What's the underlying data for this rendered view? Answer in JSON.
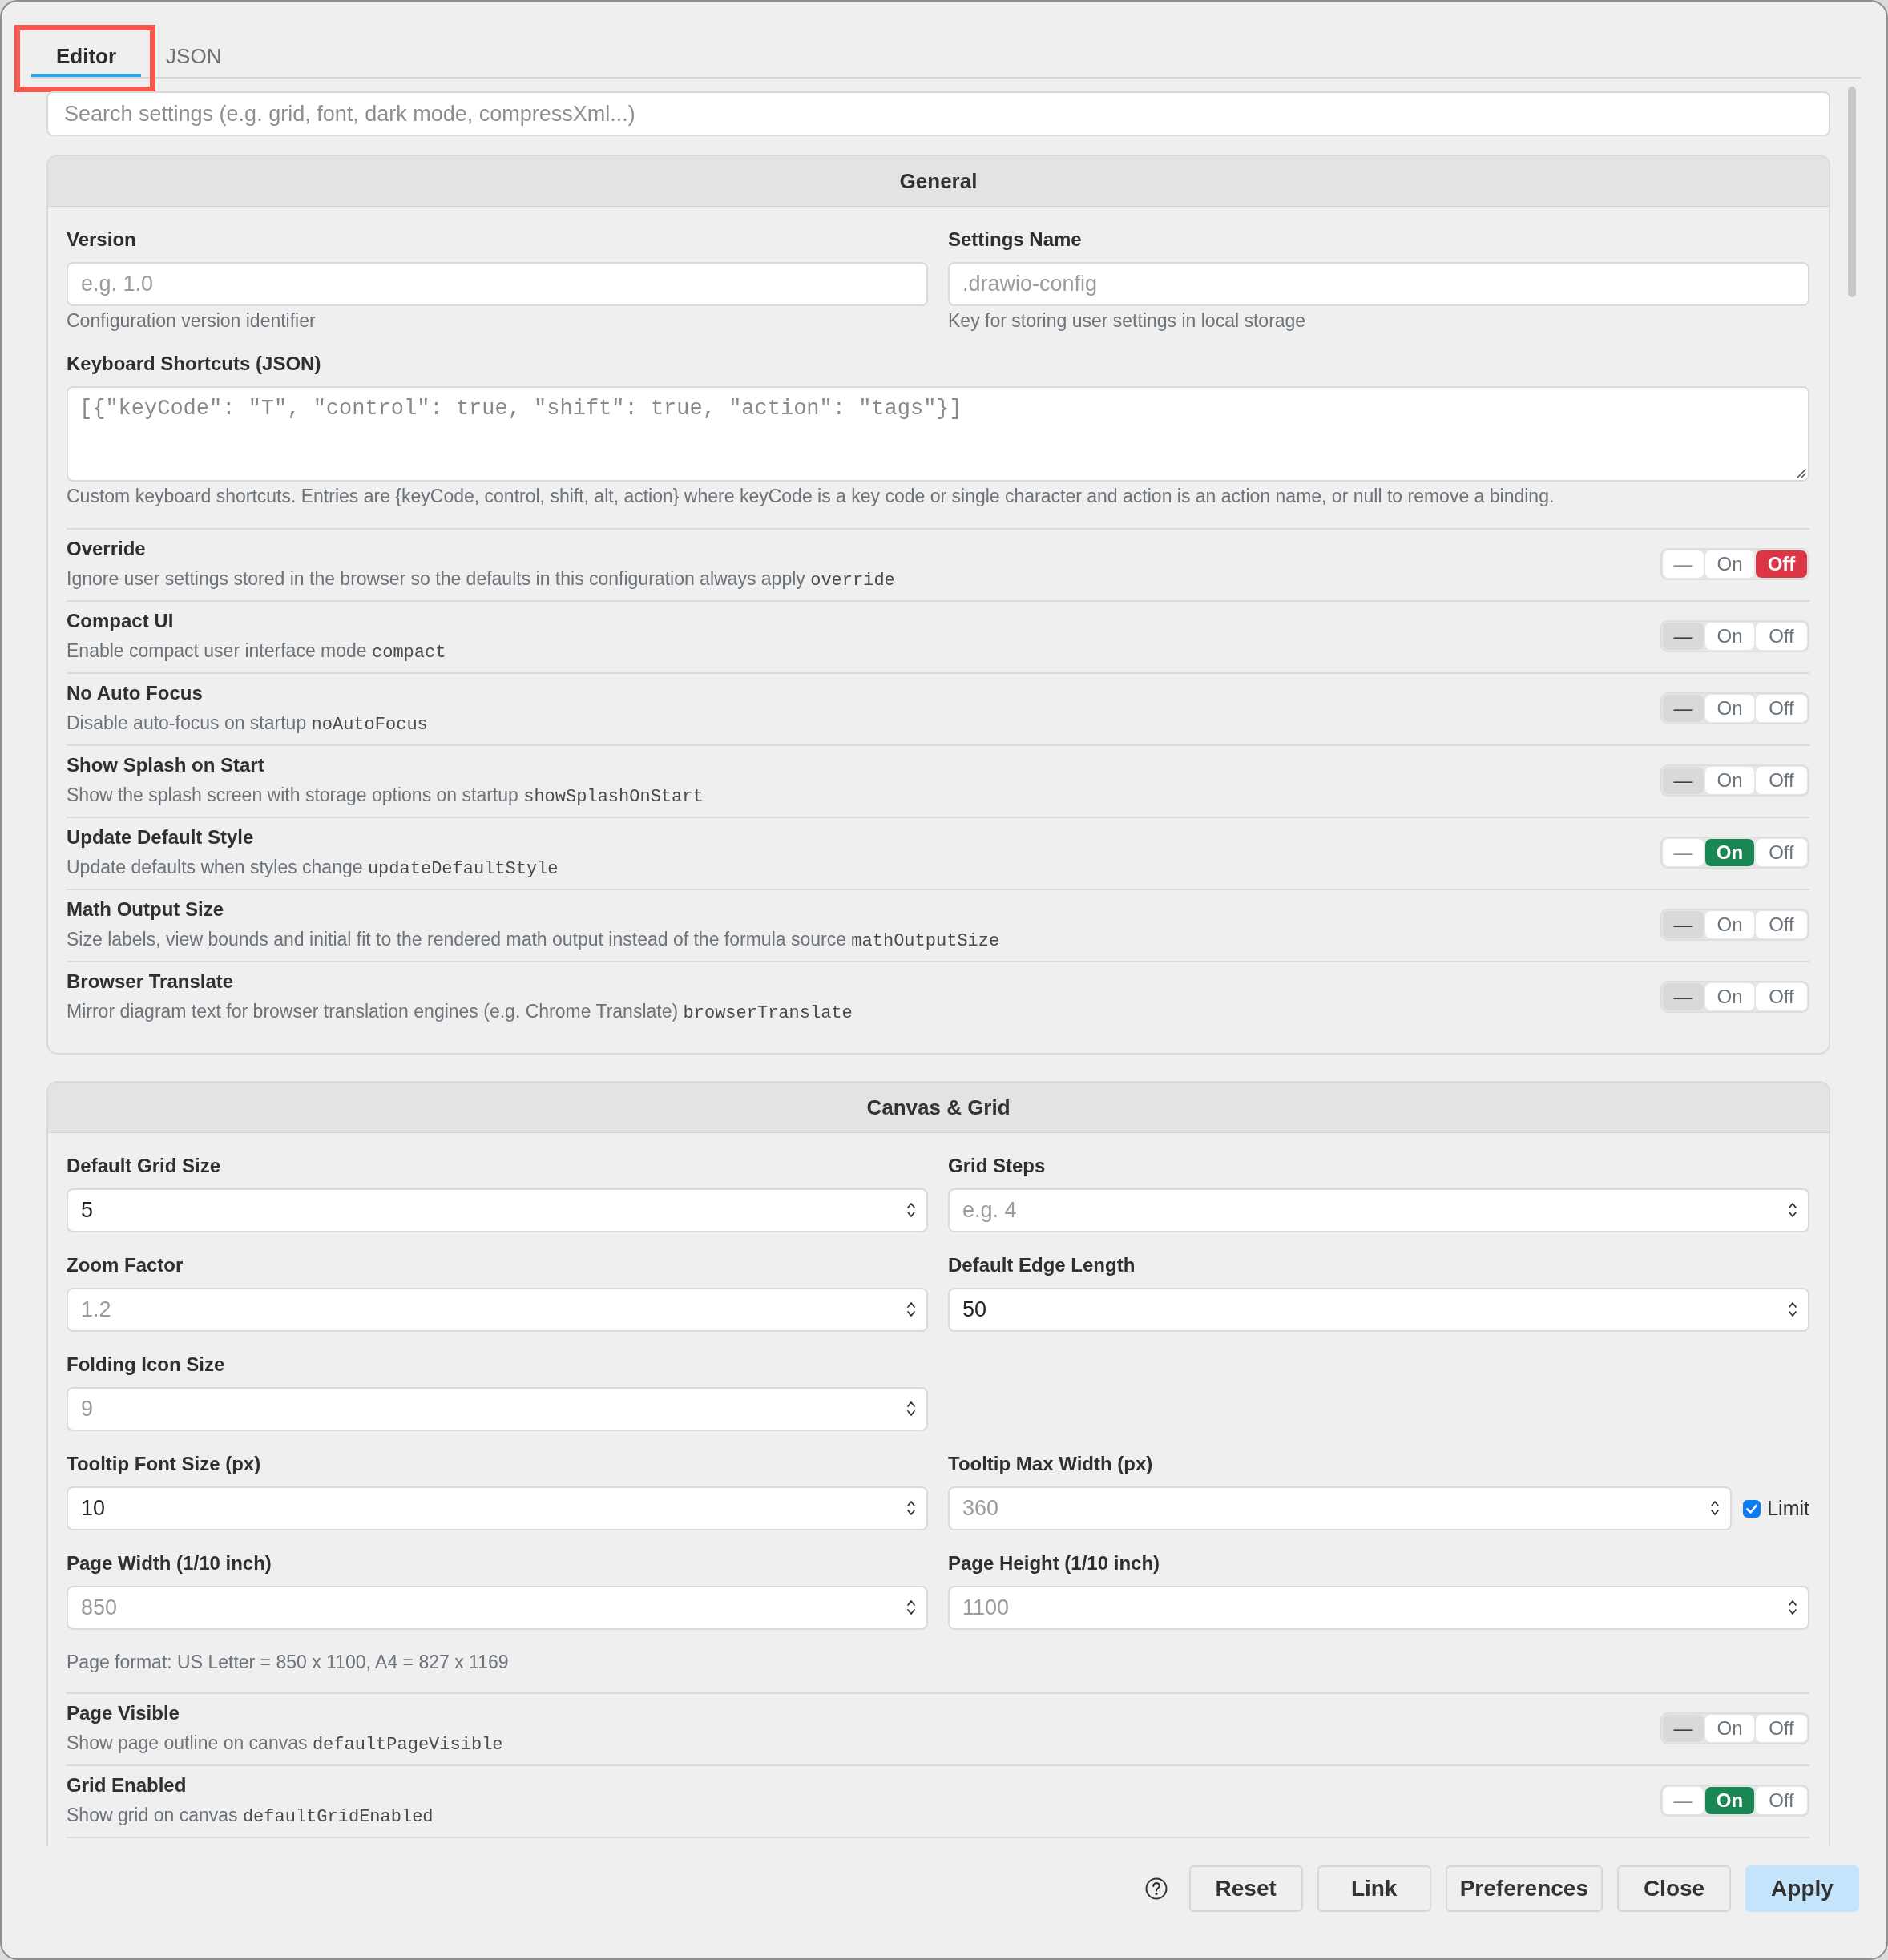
{
  "tabs": [
    {
      "label": "Editor",
      "selected": true,
      "highlighted": true
    },
    {
      "label": "JSON",
      "selected": false,
      "highlighted": false
    }
  ],
  "search": {
    "placeholder": "Search settings (e.g. grid, font, dark mode, compressXml...)"
  },
  "sections": [
    {
      "title": "General",
      "cut_off": false,
      "items": [
        {
          "kind": "fields",
          "fields": [
            {
              "kind": "text",
              "label": "Version",
              "placeholder": "e.g. 1.0",
              "help": "Configuration version identifier"
            },
            {
              "kind": "text",
              "label": "Settings Name",
              "placeholder": ".drawio-config",
              "help": "Key for storing user settings in local storage"
            }
          ]
        },
        {
          "kind": "textarea",
          "label": "Keyboard Shortcuts (JSON)",
          "placeholder": "[{\"keyCode\": \"T\", \"control\": true, \"shift\": true, \"action\": \"tags\"}]",
          "help": "Custom keyboard shortcuts. Entries are {keyCode, control, shift, alt, action} where keyCode is a key code or single character and action is an action name, or null to remove a binding."
        },
        {
          "kind": "toggle",
          "title": "Override",
          "description": "Ignore user settings stored in the browser so the defaults in this configuration always apply",
          "code": "override",
          "options": [
            {
              "kind": "unset",
              "label": "—",
              "selected": false
            },
            {
              "kind": "on",
              "label": "On",
              "selected": false
            },
            {
              "kind": "off",
              "label": "Off",
              "selected": true
            }
          ]
        },
        {
          "kind": "toggle",
          "title": "Compact UI",
          "description": "Enable compact user interface mode",
          "code": "compact",
          "options": [
            {
              "kind": "unset",
              "label": "—",
              "selected": true
            },
            {
              "kind": "on",
              "label": "On",
              "selected": false
            },
            {
              "kind": "off",
              "label": "Off",
              "selected": false
            }
          ]
        },
        {
          "kind": "toggle",
          "title": "No Auto Focus",
          "description": "Disable auto-focus on startup",
          "code": "noAutoFocus",
          "options": [
            {
              "kind": "unset",
              "label": "—",
              "selected": true
            },
            {
              "kind": "on",
              "label": "On",
              "selected": false
            },
            {
              "kind": "off",
              "label": "Off",
              "selected": false
            }
          ]
        },
        {
          "kind": "toggle",
          "title": "Show Splash on Start",
          "description": "Show the splash screen with storage options on startup",
          "code": "showSplashOnStart",
          "options": [
            {
              "kind": "unset",
              "label": "—",
              "selected": true
            },
            {
              "kind": "on",
              "label": "On",
              "selected": false
            },
            {
              "kind": "off",
              "label": "Off",
              "selected": false
            }
          ]
        },
        {
          "kind": "toggle",
          "title": "Update Default Style",
          "description": "Update defaults when styles change",
          "code": "updateDefaultStyle",
          "options": [
            {
              "kind": "unset",
              "label": "—",
              "selected": false
            },
            {
              "kind": "on",
              "label": "On",
              "selected": true
            },
            {
              "kind": "off",
              "label": "Off",
              "selected": false
            }
          ]
        },
        {
          "kind": "toggle",
          "title": "Math Output Size",
          "description": "Size labels, view bounds and initial fit to the rendered math output instead of the formula source",
          "code": "mathOutputSize",
          "options": [
            {
              "kind": "unset",
              "label": "—",
              "selected": true
            },
            {
              "kind": "on",
              "label": "On",
              "selected": false
            },
            {
              "kind": "off",
              "label": "Off",
              "selected": false
            }
          ]
        },
        {
          "kind": "toggle",
          "title": "Browser Translate",
          "description": "Mirror diagram text for browser translation engines (e.g. Chrome Translate)",
          "code": "browserTranslate",
          "options": [
            {
              "kind": "unset",
              "label": "—",
              "selected": true
            },
            {
              "kind": "on",
              "label": "On",
              "selected": false
            },
            {
              "kind": "off",
              "label": "Off",
              "selected": false
            }
          ]
        }
      ]
    },
    {
      "title": "Canvas & Grid",
      "cut_off": true,
      "items": [
        {
          "kind": "fields",
          "fields": [
            {
              "kind": "number",
              "label": "Default Grid Size",
              "value": "5"
            },
            {
              "kind": "number",
              "label": "Grid Steps",
              "placeholder": "e.g. 4"
            }
          ]
        },
        {
          "kind": "fields",
          "fields": [
            {
              "kind": "number",
              "label": "Zoom Factor",
              "placeholder": "1.2"
            },
            {
              "kind": "number",
              "label": "Default Edge Length",
              "value": "50"
            }
          ]
        },
        {
          "kind": "fields",
          "fields": [
            {
              "kind": "number",
              "label": "Folding Icon Size",
              "placeholder": "9"
            }
          ]
        },
        {
          "kind": "fields",
          "fields": [
            {
              "kind": "number",
              "label": "Tooltip Font Size (px)",
              "value": "10"
            },
            {
              "kind": "number",
              "label": "Tooltip Max Width (px)",
              "placeholder": "360",
              "checkbox": {
                "label": "Limit",
                "checked": true
              }
            }
          ]
        },
        {
          "kind": "fields",
          "fields": [
            {
              "kind": "number",
              "label": "Page Width (1/10 inch)",
              "placeholder": "850"
            },
            {
              "kind": "number",
              "label": "Page Height (1/10 inch)",
              "placeholder": "1100"
            }
          ]
        },
        {
          "kind": "note",
          "text": "Page format: US Letter = 850 x 1100, A4 = 827 x 1169"
        },
        {
          "kind": "toggle",
          "title": "Page Visible",
          "description": "Show page outline on canvas",
          "code": "defaultPageVisible",
          "options": [
            {
              "kind": "unset",
              "label": "—",
              "selected": true
            },
            {
              "kind": "on",
              "label": "On",
              "selected": false
            },
            {
              "kind": "off",
              "label": "Off",
              "selected": false
            }
          ]
        },
        {
          "kind": "toggle",
          "title": "Grid Enabled",
          "description": "Show grid on canvas",
          "code": "defaultGridEnabled",
          "options": [
            {
              "kind": "unset",
              "label": "—",
              "selected": false
            },
            {
              "kind": "on",
              "label": "On",
              "selected": true
            },
            {
              "kind": "off",
              "label": "Off",
              "selected": false
            }
          ]
        }
      ]
    }
  ],
  "footer": {
    "buttons": [
      {
        "kind": "default",
        "label": "Reset"
      },
      {
        "kind": "default",
        "label": "Link"
      },
      {
        "kind": "default",
        "label": "Preferences"
      },
      {
        "kind": "default",
        "label": "Close"
      },
      {
        "kind": "primary",
        "label": "Apply"
      }
    ]
  }
}
